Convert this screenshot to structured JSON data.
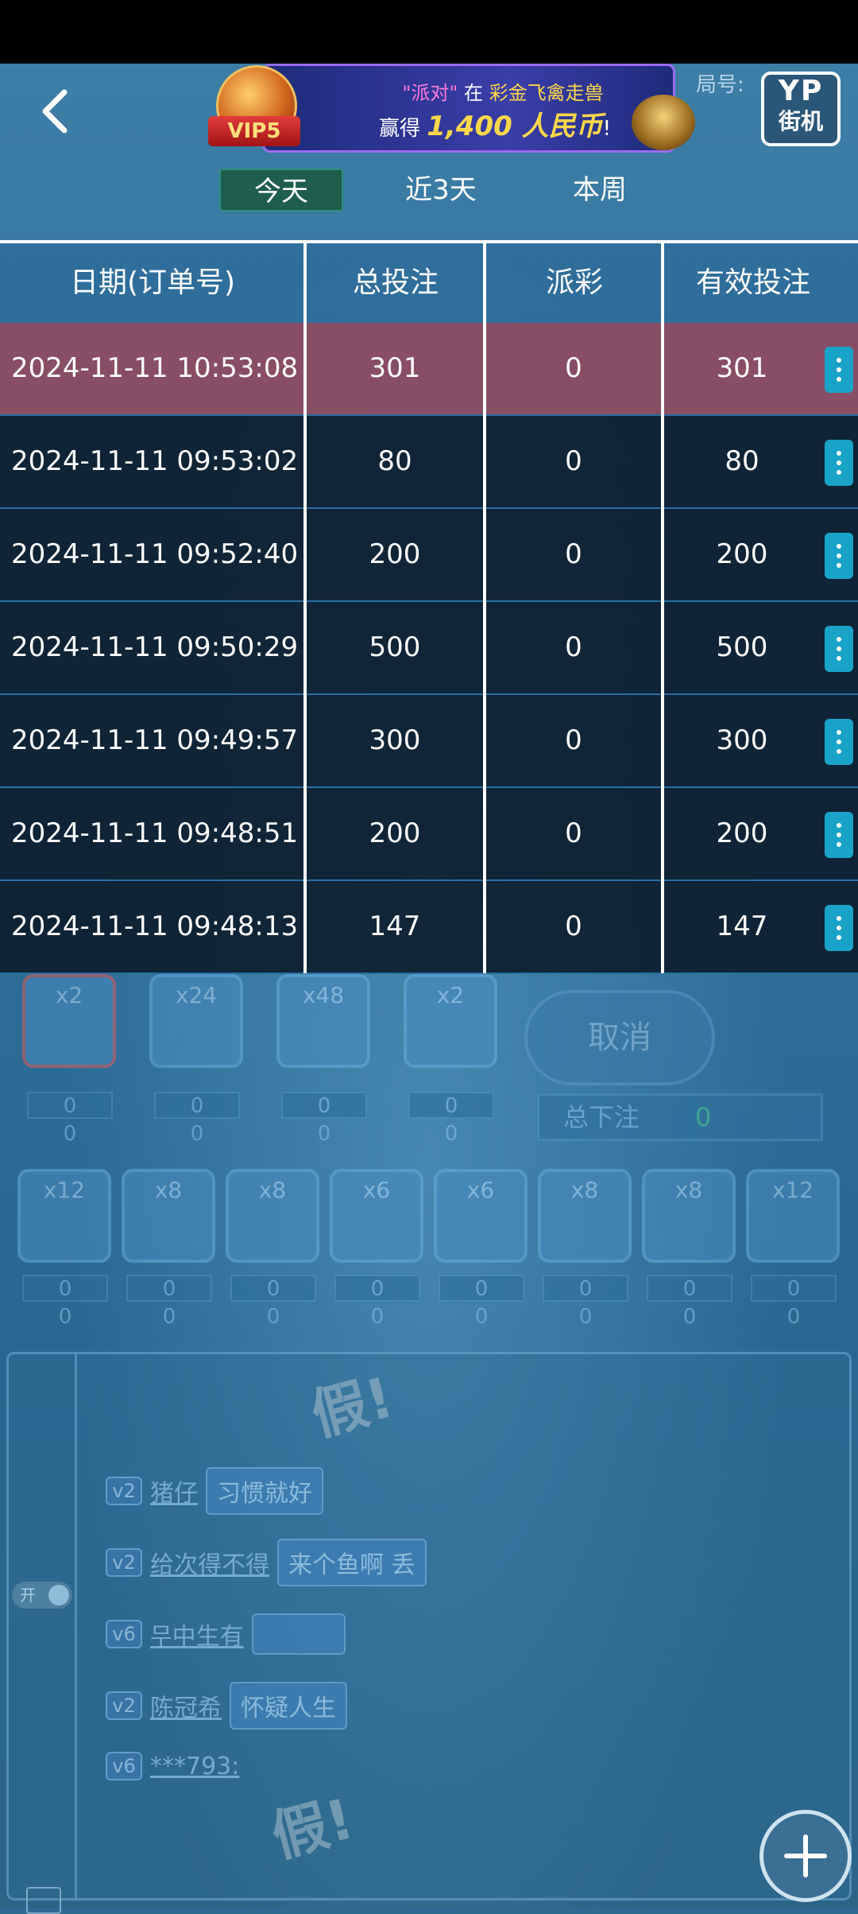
{
  "banner": {
    "vip_label": "VIP5",
    "quote_left": "\"",
    "highlight": "派对",
    "quote_right": "\"",
    "connector": "在",
    "game_name": "彩金飞禽走兽",
    "win_prefix": "赢得",
    "amount": "1,400 人民币",
    "exclaim": "!"
  },
  "logo": {
    "line1": "YP",
    "line2": "街机"
  },
  "room_label": "局号:",
  "tabs": [
    {
      "label": "今天",
      "active": true
    },
    {
      "label": "近3天",
      "active": false
    },
    {
      "label": "本周",
      "active": false
    }
  ],
  "table": {
    "headers": [
      "日期(订单号)",
      "总投注",
      "派彩",
      "有效投注"
    ],
    "rows": [
      {
        "date": "2024-11-11 10:53:08",
        "total": "301",
        "payout": "0",
        "valid": "301"
      },
      {
        "date": "2024-11-11 09:53:02",
        "total": "80",
        "payout": "0",
        "valid": "80"
      },
      {
        "date": "2024-11-11 09:52:40",
        "total": "200",
        "payout": "0",
        "valid": "200"
      },
      {
        "date": "2024-11-11 09:50:29",
        "total": "500",
        "payout": "0",
        "valid": "500"
      },
      {
        "date": "2024-11-11 09:49:57",
        "total": "300",
        "payout": "0",
        "valid": "300"
      },
      {
        "date": "2024-11-11 09:48:51",
        "total": "200",
        "payout": "0",
        "valid": "200"
      },
      {
        "date": "2024-11-11 09:48:13",
        "total": "147",
        "payout": "0",
        "valid": "147"
      }
    ]
  },
  "game": {
    "top_cards": [
      "x2",
      "x24",
      "x48",
      "x2"
    ],
    "cancel_label": "取消",
    "total_bet_label": "总下注",
    "total_bet_value": "0",
    "animal_cards": [
      "x12",
      "x8",
      "x8",
      "x6",
      "x6",
      "x8",
      "x8",
      "x12"
    ],
    "zero": "0"
  },
  "chat": {
    "toggle_label": "开",
    "stamp": "假!",
    "messages": [
      {
        "level": "v2",
        "user": "猪仔",
        "text": "习惯就好"
      },
      {
        "level": "v2",
        "user": "给次得不得",
        "text": "来个鱼啊 丢"
      },
      {
        "level": "v6",
        "user": "무中生有",
        "text": ""
      },
      {
        "level": "v2",
        "user": "陈冠希",
        "text": "怀疑人生"
      },
      {
        "level": "v6",
        "user": "***793:",
        "text": ""
      }
    ]
  },
  "colors": {
    "active_tab": "#1f5d4d",
    "highlight_row": "#96465a",
    "more_button": "#1aa3c8"
  }
}
